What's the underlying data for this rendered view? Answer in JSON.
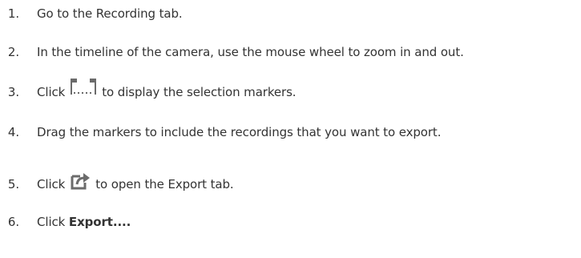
{
  "steps": [
    {
      "number": "1.",
      "text": "Go to the Recording tab."
    },
    {
      "number": "2.",
      "text": "In the timeline of the camera, use the mouse wheel to zoom in and out."
    },
    {
      "number": "3.",
      "before": "Click",
      "icon": "selection-markers-icon",
      "after": "to display the selection markers."
    },
    {
      "number": "4.",
      "text": "Drag the markers to include the recordings that you want to export."
    },
    {
      "number": "5.",
      "before": "Click",
      "icon": "export-icon",
      "after": "to open the Export tab."
    },
    {
      "number": "6.",
      "before": "Click",
      "bold": "Export...",
      "after": "."
    }
  ],
  "colors": {
    "text": "#333333",
    "icon": "#6b6b6b"
  }
}
